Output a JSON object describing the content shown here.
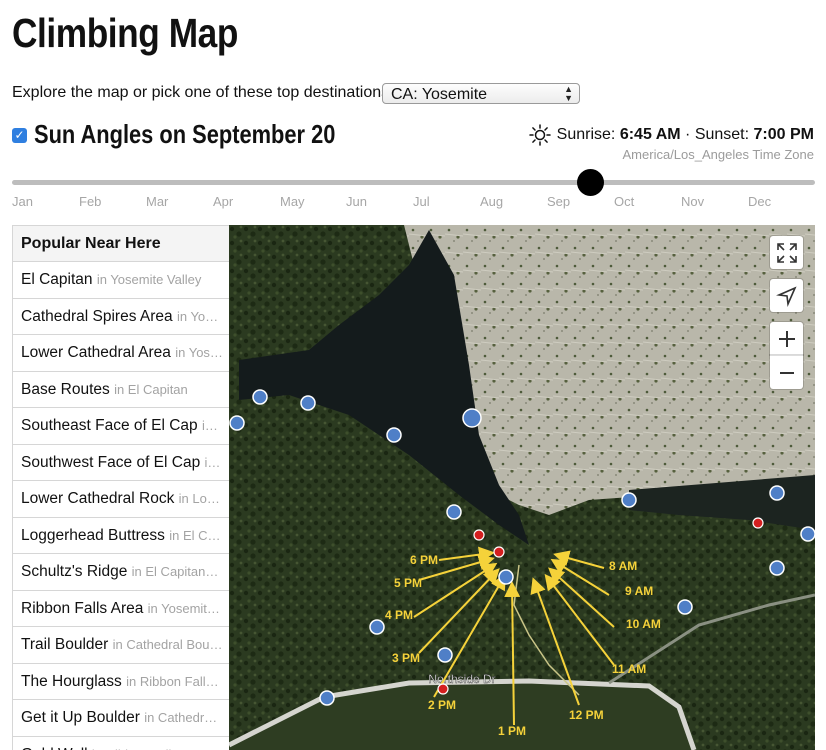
{
  "title": "Climbing Map",
  "explore": {
    "label": "Explore the map or pick one of these top destinations:",
    "selected": "CA: Yosemite"
  },
  "sun": {
    "checked": true,
    "title": "Sun Angles on September 20",
    "sunrise_label": "Sunrise:",
    "sunrise": "6:45 AM",
    "separator": "·",
    "sunset_label": "Sunset:",
    "sunset": "7:00 PM",
    "timezone": "America/Los_Angeles Time Zone"
  },
  "slider": {
    "months": [
      "Jan",
      "Feb",
      "Mar",
      "Apr",
      "May",
      "Jun",
      "Jul",
      "Aug",
      "Sep",
      "Oct",
      "Nov",
      "Dec"
    ],
    "position_fraction": 0.72
  },
  "sidebar": {
    "header": "Popular Near Here",
    "items": [
      {
        "name": "El Capitan",
        "area": "in Yosemite Valley"
      },
      {
        "name": "Cathedral Spires Area",
        "area": "in Yo…"
      },
      {
        "name": "Lower Cathedral Area",
        "area": "in Yos…"
      },
      {
        "name": "Base Routes",
        "area": "in El Capitan"
      },
      {
        "name": "Southeast Face of El Cap",
        "area": "i…"
      },
      {
        "name": "Southwest Face of El Cap",
        "area": "i…"
      },
      {
        "name": "Lower Cathedral Rock",
        "area": "in Lo…"
      },
      {
        "name": "Loggerhead Buttress",
        "area": "in El C…"
      },
      {
        "name": "Schultz's Ridge",
        "area": "in El Capitan…"
      },
      {
        "name": "Ribbon Falls Area",
        "area": "in Yosemit…"
      },
      {
        "name": "Trail Boulder",
        "area": "in Cathedral Bou…"
      },
      {
        "name": "The Hourglass",
        "area": "in Ribbon Fall…"
      },
      {
        "name": "Get it Up Boulder",
        "area": "in Cathedr…"
      },
      {
        "name": "Gold Wall",
        "area": "in Ribbon Falls Area"
      }
    ]
  },
  "map": {
    "road_label": "Northside Dr",
    "sun_times": [
      "8 AM",
      "9 AM",
      "10 AM",
      "11 AM",
      "12 PM",
      "1 PM",
      "2 PM",
      "3 PM",
      "4 PM",
      "5 PM",
      "6 PM"
    ],
    "icons": {
      "fullscreen": "fullscreen-icon",
      "locate": "locate-arrow-icon",
      "zoom_in": "plus-icon",
      "zoom_out": "minus-icon",
      "sun": "sun-icon"
    },
    "colors": {
      "sun_ray": "#f5d23a",
      "marker_blue": "#4f7fc7",
      "marker_red": "#d41f1f",
      "checkbox": "#2f7fe0"
    }
  }
}
